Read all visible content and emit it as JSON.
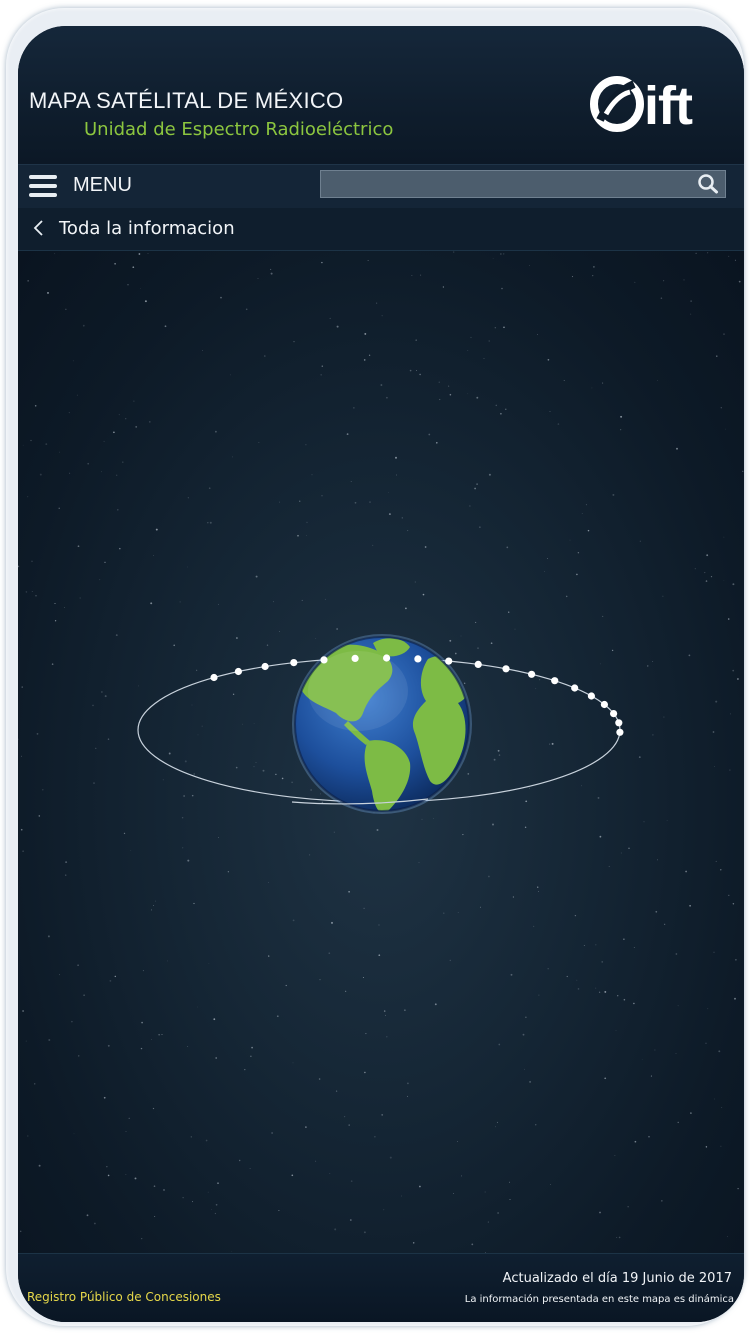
{
  "header": {
    "title": "MAPA SATÉLITAL DE MÉXICO",
    "subtitle": "Unidad de Espectro Radioeléctrico",
    "logo_text": "ift"
  },
  "navbar": {
    "menu_label": "MENU",
    "search_placeholder": "",
    "icons": {
      "menu": "hamburger-icon",
      "search": "search-icon"
    }
  },
  "breadcrumb": {
    "label": "Toda la informacion",
    "icon": "chevron-left-icon"
  },
  "footer": {
    "link": "Registro Público de Concesiones",
    "updated": "Actualizado  el día 19  Junio de 2017",
    "note": "La información presentada en este mapa es dinámica"
  },
  "colors": {
    "accent_green": "#8cc63f",
    "footer_link": "#e6d84a",
    "background": "#0b1522"
  }
}
